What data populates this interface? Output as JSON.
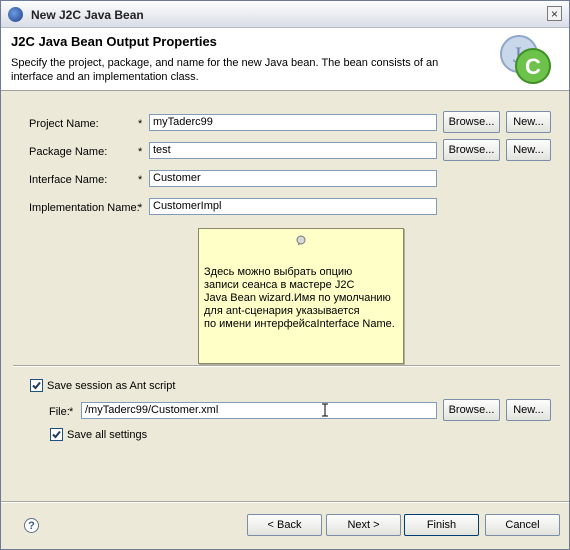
{
  "window": {
    "title": "New J2C Java Bean"
  },
  "header": {
    "title": "J2C Java Bean Output Properties",
    "description": "Specify the project, package, and name for the new Java bean.  The bean consists of an interface and an implementation class."
  },
  "form": {
    "project": {
      "label": "Project Name:",
      "required": "*",
      "value": "myTaderc99",
      "browse": "Browse...",
      "new": "New..."
    },
    "package": {
      "label": "Package Name:",
      "required": "*",
      "value": "test",
      "browse": "Browse...",
      "new": "New..."
    },
    "interface": {
      "label": "Interface Name:",
      "required": "*",
      "value": "Customer"
    },
    "implementation": {
      "label": "Implementation Name:",
      "required": "*",
      "value": "CustomerImpl"
    }
  },
  "note": {
    "lines": [
      "Здесь  можно выбрать опцию",
      "записи сеанса в мастере  J2C",
      "Java Bean  wizard.Имя по умолчанию",
      "для ant-сценария  указывается",
      "по имени интерфейсаInterface Name."
    ]
  },
  "session": {
    "save_ant_label": "Save session as Ant script",
    "save_ant_checked": true,
    "file_label": "File:",
    "file_required": "*",
    "file_value": "/myTaderc99/Customer.xml",
    "browse": "Browse...",
    "new": "New...",
    "save_all_label": "Save all settings",
    "save_all_checked": true
  },
  "footer": {
    "help_icon": "?",
    "back": "< Back",
    "next": "Next >",
    "finish": "Finish",
    "cancel": "Cancel"
  },
  "colors": {
    "note_bg": "#ffffc8",
    "dialog_bg": "#ece9d8",
    "field_border": "#7f9db9"
  }
}
